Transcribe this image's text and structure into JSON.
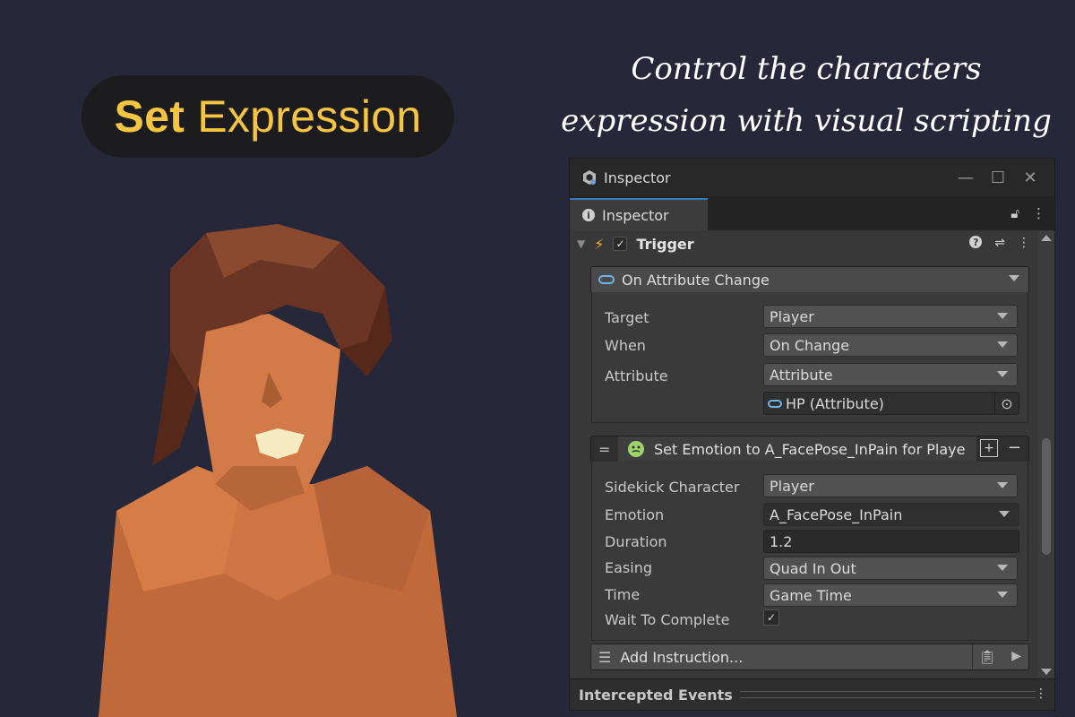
{
  "banner": {
    "title_bold": "Set",
    "title_rest": "Expression",
    "tagline_line1": "Control the characters",
    "tagline_line2": "expression with visual scripting"
  },
  "colors": {
    "background": "#27273a",
    "title_accent": "#f5c542",
    "inspector_bg": "#383838",
    "tab_accent": "#3a79bb",
    "bolt": "#f0b429"
  },
  "inspector": {
    "window_title": "Inspector",
    "tab_label": "Inspector",
    "component": {
      "title": "Trigger",
      "enabled": true,
      "event": {
        "label": "On Attribute Change",
        "fields": [
          {
            "label": "Target",
            "value": "Player"
          },
          {
            "label": "When",
            "value": "On Change"
          },
          {
            "label": "Attribute",
            "value": "Attribute"
          }
        ],
        "attribute_ref": "HP (Attribute)"
      },
      "instruction": {
        "label": "Set Emotion to A_FacePose_InPain for Playe",
        "fields": [
          {
            "label": "Sidekick Character",
            "value": "Player"
          },
          {
            "label": "Emotion",
            "value": "A_FacePose_InPain"
          },
          {
            "label": "Duration",
            "value": "1.2"
          },
          {
            "label": "Easing",
            "value": "Quad In Out"
          },
          {
            "label": "Time",
            "value": "Game Time"
          },
          {
            "label": "Wait To Complete",
            "value": true
          }
        ]
      },
      "add_instruction_label": "Add Instruction..."
    },
    "footer_title": "Intercepted Events"
  },
  "icons": [
    "unity-icon",
    "minimize-icon",
    "maximize-icon",
    "close-icon",
    "info-icon",
    "lock-icon",
    "kebab-menu-icon",
    "bolt-icon",
    "help-icon",
    "sliders-icon",
    "chevron-down-icon",
    "attribute-icon",
    "target-icon",
    "instruction-icon",
    "drag-handle-icon",
    "plus-icon",
    "minus-icon",
    "clipboard-icon",
    "play-icon"
  ]
}
